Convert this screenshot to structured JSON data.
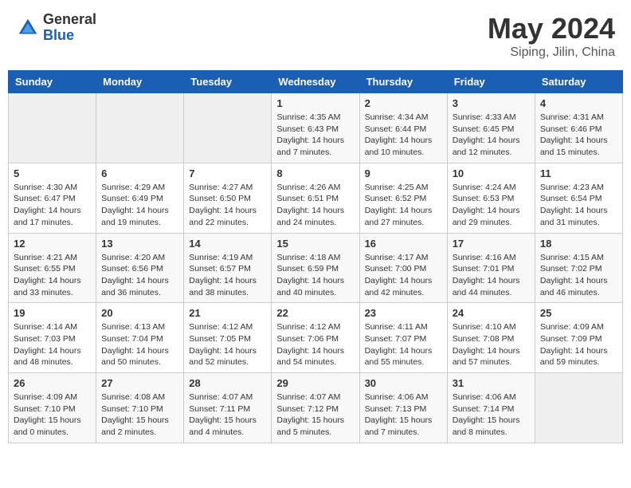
{
  "header": {
    "logo_general": "General",
    "logo_blue": "Blue",
    "title": "May 2024",
    "location": "Siping, Jilin, China"
  },
  "days_of_week": [
    "Sunday",
    "Monday",
    "Tuesday",
    "Wednesday",
    "Thursday",
    "Friday",
    "Saturday"
  ],
  "weeks": [
    [
      {
        "day": "",
        "info": ""
      },
      {
        "day": "",
        "info": ""
      },
      {
        "day": "",
        "info": ""
      },
      {
        "day": "1",
        "info": "Sunrise: 4:35 AM\nSunset: 6:43 PM\nDaylight: 14 hours\nand 7 minutes."
      },
      {
        "day": "2",
        "info": "Sunrise: 4:34 AM\nSunset: 6:44 PM\nDaylight: 14 hours\nand 10 minutes."
      },
      {
        "day": "3",
        "info": "Sunrise: 4:33 AM\nSunset: 6:45 PM\nDaylight: 14 hours\nand 12 minutes."
      },
      {
        "day": "4",
        "info": "Sunrise: 4:31 AM\nSunset: 6:46 PM\nDaylight: 14 hours\nand 15 minutes."
      }
    ],
    [
      {
        "day": "5",
        "info": "Sunrise: 4:30 AM\nSunset: 6:47 PM\nDaylight: 14 hours\nand 17 minutes."
      },
      {
        "day": "6",
        "info": "Sunrise: 4:29 AM\nSunset: 6:49 PM\nDaylight: 14 hours\nand 19 minutes."
      },
      {
        "day": "7",
        "info": "Sunrise: 4:27 AM\nSunset: 6:50 PM\nDaylight: 14 hours\nand 22 minutes."
      },
      {
        "day": "8",
        "info": "Sunrise: 4:26 AM\nSunset: 6:51 PM\nDaylight: 14 hours\nand 24 minutes."
      },
      {
        "day": "9",
        "info": "Sunrise: 4:25 AM\nSunset: 6:52 PM\nDaylight: 14 hours\nand 27 minutes."
      },
      {
        "day": "10",
        "info": "Sunrise: 4:24 AM\nSunset: 6:53 PM\nDaylight: 14 hours\nand 29 minutes."
      },
      {
        "day": "11",
        "info": "Sunrise: 4:23 AM\nSunset: 6:54 PM\nDaylight: 14 hours\nand 31 minutes."
      }
    ],
    [
      {
        "day": "12",
        "info": "Sunrise: 4:21 AM\nSunset: 6:55 PM\nDaylight: 14 hours\nand 33 minutes."
      },
      {
        "day": "13",
        "info": "Sunrise: 4:20 AM\nSunset: 6:56 PM\nDaylight: 14 hours\nand 36 minutes."
      },
      {
        "day": "14",
        "info": "Sunrise: 4:19 AM\nSunset: 6:57 PM\nDaylight: 14 hours\nand 38 minutes."
      },
      {
        "day": "15",
        "info": "Sunrise: 4:18 AM\nSunset: 6:59 PM\nDaylight: 14 hours\nand 40 minutes."
      },
      {
        "day": "16",
        "info": "Sunrise: 4:17 AM\nSunset: 7:00 PM\nDaylight: 14 hours\nand 42 minutes."
      },
      {
        "day": "17",
        "info": "Sunrise: 4:16 AM\nSunset: 7:01 PM\nDaylight: 14 hours\nand 44 minutes."
      },
      {
        "day": "18",
        "info": "Sunrise: 4:15 AM\nSunset: 7:02 PM\nDaylight: 14 hours\nand 46 minutes."
      }
    ],
    [
      {
        "day": "19",
        "info": "Sunrise: 4:14 AM\nSunset: 7:03 PM\nDaylight: 14 hours\nand 48 minutes."
      },
      {
        "day": "20",
        "info": "Sunrise: 4:13 AM\nSunset: 7:04 PM\nDaylight: 14 hours\nand 50 minutes."
      },
      {
        "day": "21",
        "info": "Sunrise: 4:12 AM\nSunset: 7:05 PM\nDaylight: 14 hours\nand 52 minutes."
      },
      {
        "day": "22",
        "info": "Sunrise: 4:12 AM\nSunset: 7:06 PM\nDaylight: 14 hours\nand 54 minutes."
      },
      {
        "day": "23",
        "info": "Sunrise: 4:11 AM\nSunset: 7:07 PM\nDaylight: 14 hours\nand 55 minutes."
      },
      {
        "day": "24",
        "info": "Sunrise: 4:10 AM\nSunset: 7:08 PM\nDaylight: 14 hours\nand 57 minutes."
      },
      {
        "day": "25",
        "info": "Sunrise: 4:09 AM\nSunset: 7:09 PM\nDaylight: 14 hours\nand 59 minutes."
      }
    ],
    [
      {
        "day": "26",
        "info": "Sunrise: 4:09 AM\nSunset: 7:10 PM\nDaylight: 15 hours\nand 0 minutes."
      },
      {
        "day": "27",
        "info": "Sunrise: 4:08 AM\nSunset: 7:10 PM\nDaylight: 15 hours\nand 2 minutes."
      },
      {
        "day": "28",
        "info": "Sunrise: 4:07 AM\nSunset: 7:11 PM\nDaylight: 15 hours\nand 4 minutes."
      },
      {
        "day": "29",
        "info": "Sunrise: 4:07 AM\nSunset: 7:12 PM\nDaylight: 15 hours\nand 5 minutes."
      },
      {
        "day": "30",
        "info": "Sunrise: 4:06 AM\nSunset: 7:13 PM\nDaylight: 15 hours\nand 7 minutes."
      },
      {
        "day": "31",
        "info": "Sunrise: 4:06 AM\nSunset: 7:14 PM\nDaylight: 15 hours\nand 8 minutes."
      },
      {
        "day": "",
        "info": ""
      }
    ]
  ]
}
